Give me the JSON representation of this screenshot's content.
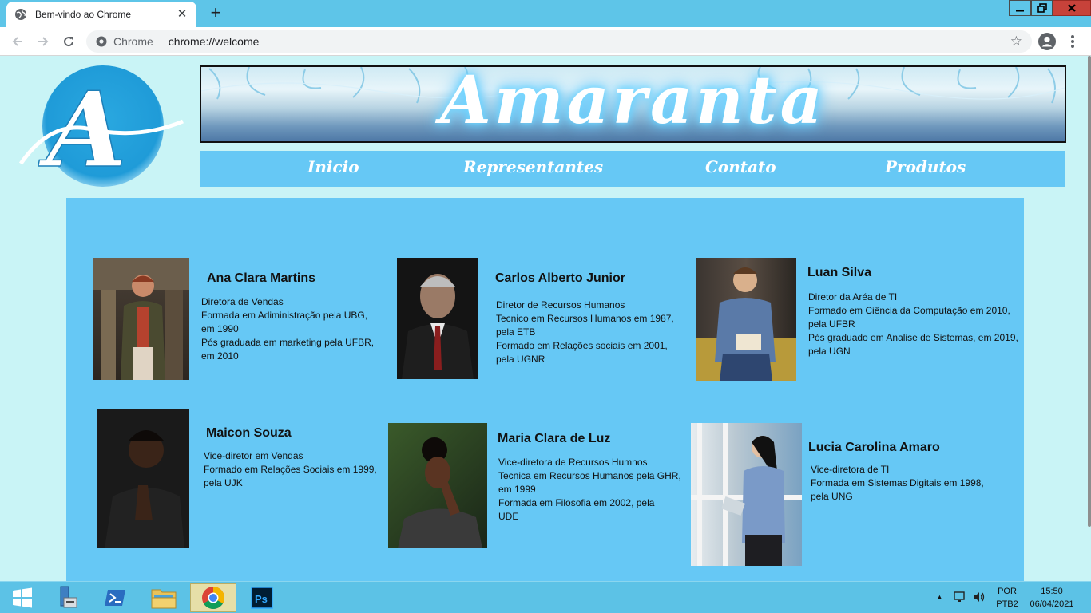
{
  "browser": {
    "tab_title": "Bem-vindo ao Chrome",
    "tab_close": "✕",
    "new_tab": "+",
    "omnibox_chip": "Chrome",
    "url": "chrome://welcome",
    "bookmark_star": "☆"
  },
  "site": {
    "logo_letter": "A",
    "banner_title": "Amaranta",
    "menu": [
      "Inicio",
      "Representantes",
      "Contato",
      "Produtos"
    ]
  },
  "representatives": [
    {
      "name": "Ana Clara Martins",
      "bio": [
        "Diretora de Vendas",
        "Formada em Adiministração pela UBG,",
        "em 1990",
        "Pós graduada em marketing pela UFBR,",
        "em 2010"
      ]
    },
    {
      "name": "Carlos Alberto Junior",
      "bio": [
        "Diretor de Recursos Humanos",
        "Tecnico em Recursos Humanos em 1987,",
        "pela ETB",
        "Formado em Relações sociais em 2001,",
        "pela UGNR"
      ]
    },
    {
      "name": "Luan Silva",
      "bio": [
        "Diretor da Aréa de TI",
        "Formado em Ciência da Computação em 2010,",
        "pela UFBR",
        "Pós graduado em Analise de Sistemas, em 2019,",
        "pela UGN"
      ]
    },
    {
      "name": "Maicon Souza",
      "bio": [
        "Vice-diretor em Vendas",
        "Formado em Relações Sociais em 1999,",
        "pela UJK"
      ]
    },
    {
      "name": "Maria Clara de Luz",
      "bio": [
        "Vice-diretora de Recursos Humnos",
        "Tecnica em Recursos Humanos pela GHR,",
        "em 1999",
        "Formada em Filosofia em 2002, pela",
        "UDE"
      ]
    },
    {
      "name": "Lucia Carolina Amaro",
      "bio": [
        "Vice-diretora de TI",
        "Formada em Sistemas Digitais em 1998,",
        "pela UNG"
      ]
    }
  ],
  "taskbar": {
    "lang_1": "POR",
    "lang_2": "PTB2",
    "time": "15:50",
    "date": "06/04/2021",
    "tray_arrow": "▲"
  }
}
